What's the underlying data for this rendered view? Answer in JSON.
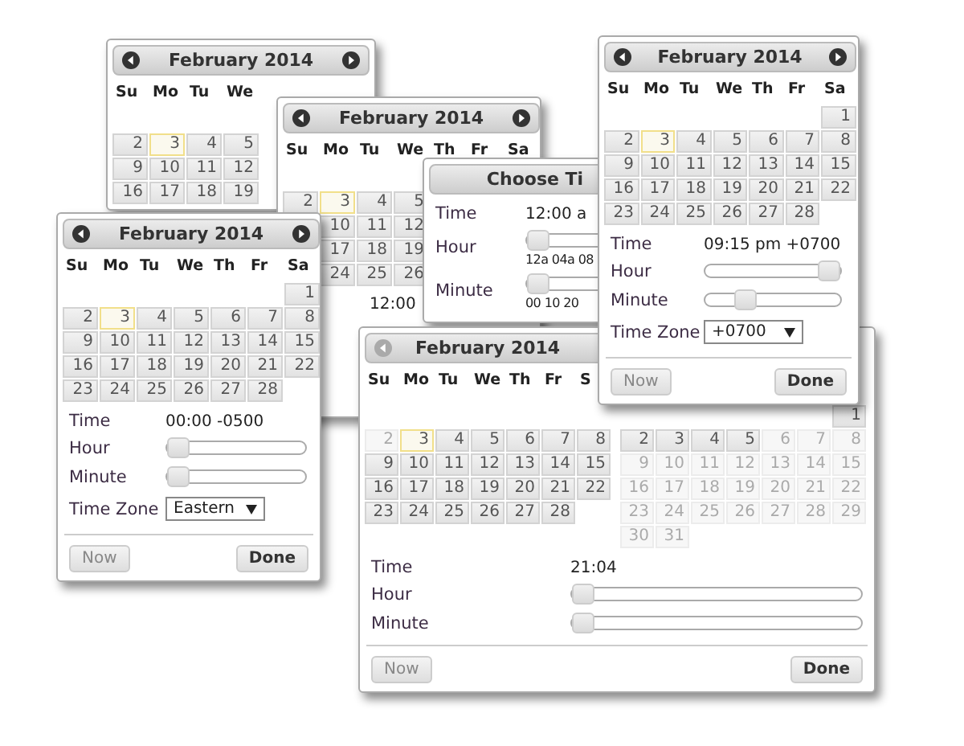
{
  "windows": [
    {
      "kind": "datepicker",
      "months": [
        {
          "title": "February 2014",
          "prev": {
            "disabled": false
          },
          "next": {
            "disabled": false
          },
          "weekdays": [
            "Su",
            "Mo",
            "Tu",
            "We"
          ],
          "weeks": [
            [
              {
                "kind": "blank"
              }
            ],
            [
              {
                "kind": "day",
                "day": "2",
                "today": false,
                "disabled": false
              },
              {
                "kind": "day",
                "day": "3",
                "today": true,
                "disabled": false
              },
              {
                "kind": "day",
                "day": "4",
                "today": false,
                "disabled": false
              },
              {
                "kind": "day",
                "day": "5",
                "today": false,
                "disabled": false
              }
            ],
            [
              {
                "kind": "day",
                "day": "9",
                "today": false,
                "disabled": false
              },
              {
                "kind": "day",
                "day": "10",
                "today": false,
                "disabled": false
              },
              {
                "kind": "day",
                "day": "11",
                "today": false,
                "disabled": false
              },
              {
                "kind": "day",
                "day": "12",
                "today": false,
                "disabled": false
              }
            ],
            [
              {
                "kind": "day",
                "day": "16",
                "today": false,
                "disabled": false
              },
              {
                "kind": "day",
                "day": "17",
                "today": false,
                "disabled": false
              },
              {
                "kind": "day",
                "day": "18",
                "today": false,
                "disabled": false
              },
              {
                "kind": "day",
                "day": "19",
                "today": false,
                "disabled": false
              }
            ]
          ]
        }
      ]
    },
    {
      "kind": "datepicker",
      "months": [
        {
          "title": "February 2014",
          "prev": {
            "disabled": false
          },
          "next": {
            "disabled": false
          },
          "weekdays": [
            "Su",
            "Mo",
            "Tu",
            "We",
            "Th",
            "Fr",
            "Sa"
          ],
          "weeks": [
            [
              {
                "kind": "blank"
              }
            ],
            [
              {
                "kind": "day",
                "day": "2",
                "today": false,
                "disabled": false
              },
              {
                "kind": "day",
                "day": "3",
                "today": true,
                "disabled": false
              },
              {
                "kind": "day",
                "day": "4",
                "today": false,
                "disabled": false
              },
              {
                "kind": "day",
                "day": "5",
                "today": false,
                "disabled": false
              }
            ],
            [
              {
                "kind": "blank"
              },
              {
                "kind": "day",
                "day": "10",
                "today": false,
                "disabled": false
              },
              {
                "kind": "day",
                "day": "11",
                "today": false,
                "disabled": false
              },
              {
                "kind": "day",
                "day": "12",
                "today": false,
                "disabled": false
              }
            ],
            [
              {
                "kind": "blank"
              },
              {
                "kind": "day",
                "day": "17",
                "today": false,
                "disabled": false
              },
              {
                "kind": "day",
                "day": "18",
                "today": false,
                "disabled": false
              },
              {
                "kind": "day",
                "day": "19",
                "today": false,
                "disabled": false
              }
            ],
            [
              {
                "kind": "blank"
              },
              {
                "kind": "day",
                "day": "24",
                "today": false,
                "disabled": false
              },
              {
                "kind": "day",
                "day": "25",
                "today": false,
                "disabled": false
              },
              {
                "kind": "day",
                "day": "26",
                "today": false,
                "disabled": false
              }
            ]
          ]
        }
      ],
      "time": [
        {
          "kind": "text",
          "value": "12:00"
        }
      ]
    },
    {
      "kind": "timepicker",
      "title": "Choose Ti",
      "time": [
        {
          "kind": "text",
          "label": "Time",
          "value": "12:00 a"
        },
        {
          "kind": "slider",
          "label": "Hour",
          "level": 0,
          "ticks": "12a 04a 08"
        },
        {
          "kind": "slider",
          "label": "Minute",
          "level": 0,
          "ticks": "00 10 20"
        }
      ]
    },
    {
      "kind": "datepicker",
      "months": [
        {
          "title": "February 2014",
          "prev": {
            "disabled": false
          },
          "next": {
            "disabled": false
          },
          "weekdays": [
            "Su",
            "Mo",
            "Tu",
            "We",
            "Th",
            "Fr",
            "Sa"
          ],
          "weeks": [
            [
              {
                "kind": "blank"
              },
              {
                "kind": "blank"
              },
              {
                "kind": "blank"
              },
              {
                "kind": "blank"
              },
              {
                "kind": "blank"
              },
              {
                "kind": "blank"
              },
              {
                "kind": "day",
                "day": "1",
                "today": false,
                "disabled": false
              }
            ],
            [
              {
                "kind": "day",
                "day": "2",
                "today": false,
                "disabled": false
              },
              {
                "kind": "day",
                "day": "3",
                "today": true,
                "disabled": false
              },
              {
                "kind": "day",
                "day": "4",
                "today": false,
                "disabled": false
              },
              {
                "kind": "day",
                "day": "5",
                "today": false,
                "disabled": false
              },
              {
                "kind": "day",
                "day": "6",
                "today": false,
                "disabled": false
              },
              {
                "kind": "day",
                "day": "7",
                "today": false,
                "disabled": false
              },
              {
                "kind": "day",
                "day": "8",
                "today": false,
                "disabled": false
              }
            ],
            [
              {
                "kind": "day",
                "day": "9",
                "today": false,
                "disabled": false
              },
              {
                "kind": "day",
                "day": "10",
                "today": false,
                "disabled": false
              },
              {
                "kind": "day",
                "day": "11",
                "today": false,
                "disabled": false
              },
              {
                "kind": "day",
                "day": "12",
                "today": false,
                "disabled": false
              },
              {
                "kind": "day",
                "day": "13",
                "today": false,
                "disabled": false
              },
              {
                "kind": "day",
                "day": "14",
                "today": false,
                "disabled": false
              },
              {
                "kind": "day",
                "day": "15",
                "today": false,
                "disabled": false
              }
            ],
            [
              {
                "kind": "day",
                "day": "16",
                "today": false,
                "disabled": false
              },
              {
                "kind": "day",
                "day": "17",
                "today": false,
                "disabled": false
              },
              {
                "kind": "day",
                "day": "18",
                "today": false,
                "disabled": false
              },
              {
                "kind": "day",
                "day": "19",
                "today": false,
                "disabled": false
              },
              {
                "kind": "day",
                "day": "20",
                "today": false,
                "disabled": false
              },
              {
                "kind": "day",
                "day": "21",
                "today": false,
                "disabled": false
              },
              {
                "kind": "day",
                "day": "22",
                "today": false,
                "disabled": false
              }
            ],
            [
              {
                "kind": "day",
                "day": "23",
                "today": false,
                "disabled": false
              },
              {
                "kind": "day",
                "day": "24",
                "today": false,
                "disabled": false
              },
              {
                "kind": "day",
                "day": "25",
                "today": false,
                "disabled": false
              },
              {
                "kind": "day",
                "day": "26",
                "today": false,
                "disabled": false
              },
              {
                "kind": "day",
                "day": "27",
                "today": false,
                "disabled": false
              },
              {
                "kind": "day",
                "day": "28",
                "today": false,
                "disabled": false
              }
            ]
          ]
        }
      ],
      "time": [
        {
          "kind": "text",
          "label": "Time",
          "value": "00:00 -0500"
        },
        {
          "kind": "slider",
          "label": "Hour",
          "level": 0
        },
        {
          "kind": "slider",
          "label": "Minute",
          "level": 0
        },
        {
          "kind": "select",
          "label": "Time Zone",
          "value": "Eastern"
        }
      ],
      "footer": {
        "now": {
          "label": "Now",
          "disabled": true
        },
        "done": {
          "label": "Done",
          "disabled": false
        }
      }
    },
    {
      "kind": "datepicker",
      "months": [
        {
          "title": "February 2014",
          "prev": {
            "disabled": true
          },
          "weekdays": [
            "Su",
            "Mo",
            "Tu",
            "We",
            "Th",
            "Fr",
            "S"
          ],
          "weeks": [
            [
              {
                "kind": "blank"
              }
            ],
            [
              {
                "kind": "day",
                "day": "2",
                "today": false,
                "disabled": true
              },
              {
                "kind": "day",
                "day": "3",
                "today": true,
                "disabled": false
              },
              {
                "kind": "day",
                "day": "4",
                "today": false,
                "disabled": false
              },
              {
                "kind": "day",
                "day": "5",
                "today": false,
                "disabled": false
              },
              {
                "kind": "day",
                "day": "6",
                "today": false,
                "disabled": false
              },
              {
                "kind": "day",
                "day": "7",
                "today": false,
                "disabled": false
              },
              {
                "kind": "day",
                "day": "8",
                "today": false,
                "disabled": false
              }
            ],
            [
              {
                "kind": "day",
                "day": "9",
                "today": false,
                "disabled": false
              },
              {
                "kind": "day",
                "day": "10",
                "today": false,
                "disabled": false
              },
              {
                "kind": "day",
                "day": "11",
                "today": false,
                "disabled": false
              },
              {
                "kind": "day",
                "day": "12",
                "today": false,
                "disabled": false
              },
              {
                "kind": "day",
                "day": "13",
                "today": false,
                "disabled": false
              },
              {
                "kind": "day",
                "day": "14",
                "today": false,
                "disabled": false
              },
              {
                "kind": "day",
                "day": "15",
                "today": false,
                "disabled": false
              }
            ],
            [
              {
                "kind": "day",
                "day": "16",
                "today": false,
                "disabled": false
              },
              {
                "kind": "day",
                "day": "17",
                "today": false,
                "disabled": false
              },
              {
                "kind": "day",
                "day": "18",
                "today": false,
                "disabled": false
              },
              {
                "kind": "day",
                "day": "19",
                "today": false,
                "disabled": false
              },
              {
                "kind": "day",
                "day": "20",
                "today": false,
                "disabled": false
              },
              {
                "kind": "day",
                "day": "21",
                "today": false,
                "disabled": false
              },
              {
                "kind": "day",
                "day": "22",
                "today": false,
                "disabled": false
              }
            ],
            [
              {
                "kind": "day",
                "day": "23",
                "today": false,
                "disabled": false
              },
              {
                "kind": "day",
                "day": "24",
                "today": false,
                "disabled": false
              },
              {
                "kind": "day",
                "day": "25",
                "today": false,
                "disabled": false
              },
              {
                "kind": "day",
                "day": "26",
                "today": false,
                "disabled": false
              },
              {
                "kind": "day",
                "day": "27",
                "today": false,
                "disabled": false
              },
              {
                "kind": "day",
                "day": "28",
                "today": false,
                "disabled": false
              }
            ]
          ]
        },
        {
          "weeks": [
            [
              {
                "kind": "blank"
              },
              {
                "kind": "blank"
              },
              {
                "kind": "blank"
              },
              {
                "kind": "blank"
              },
              {
                "kind": "blank"
              },
              {
                "kind": "blank"
              },
              {
                "kind": "day",
                "day": "1",
                "today": false,
                "disabled": false
              }
            ],
            [
              {
                "kind": "day",
                "day": "2",
                "today": false,
                "disabled": false
              },
              {
                "kind": "day",
                "day": "3",
                "today": false,
                "disabled": false
              },
              {
                "kind": "day",
                "day": "4",
                "today": false,
                "disabled": false
              },
              {
                "kind": "day",
                "day": "5",
                "today": false,
                "disabled": false
              },
              {
                "kind": "day",
                "day": "6",
                "today": false,
                "disabled": true
              },
              {
                "kind": "day",
                "day": "7",
                "today": false,
                "disabled": true
              },
              {
                "kind": "day",
                "day": "8",
                "today": false,
                "disabled": true
              }
            ],
            [
              {
                "kind": "day",
                "day": "9",
                "today": false,
                "disabled": true
              },
              {
                "kind": "day",
                "day": "10",
                "today": false,
                "disabled": true
              },
              {
                "kind": "day",
                "day": "11",
                "today": false,
                "disabled": true
              },
              {
                "kind": "day",
                "day": "12",
                "today": false,
                "disabled": true
              },
              {
                "kind": "day",
                "day": "13",
                "today": false,
                "disabled": true
              },
              {
                "kind": "day",
                "day": "14",
                "today": false,
                "disabled": true
              },
              {
                "kind": "day",
                "day": "15",
                "today": false,
                "disabled": true
              }
            ],
            [
              {
                "kind": "day",
                "day": "16",
                "today": false,
                "disabled": true
              },
              {
                "kind": "day",
                "day": "17",
                "today": false,
                "disabled": true
              },
              {
                "kind": "day",
                "day": "18",
                "today": false,
                "disabled": true
              },
              {
                "kind": "day",
                "day": "19",
                "today": false,
                "disabled": true
              },
              {
                "kind": "day",
                "day": "20",
                "today": false,
                "disabled": true
              },
              {
                "kind": "day",
                "day": "21",
                "today": false,
                "disabled": true
              },
              {
                "kind": "day",
                "day": "22",
                "today": false,
                "disabled": true
              }
            ],
            [
              {
                "kind": "day",
                "day": "23",
                "today": false,
                "disabled": true
              },
              {
                "kind": "day",
                "day": "24",
                "today": false,
                "disabled": true
              },
              {
                "kind": "day",
                "day": "25",
                "today": false,
                "disabled": true
              },
              {
                "kind": "day",
                "day": "26",
                "today": false,
                "disabled": true
              },
              {
                "kind": "day",
                "day": "27",
                "today": false,
                "disabled": true
              },
              {
                "kind": "day",
                "day": "28",
                "today": false,
                "disabled": true
              },
              {
                "kind": "day",
                "day": "29",
                "today": false,
                "disabled": true
              }
            ],
            [
              {
                "kind": "day",
                "day": "30",
                "today": false,
                "disabled": true
              },
              {
                "kind": "day",
                "day": "31",
                "today": false,
                "disabled": true
              }
            ]
          ]
        }
      ],
      "time": [
        {
          "kind": "text",
          "label": "Time",
          "value": "21:04"
        },
        {
          "kind": "slider",
          "label": "Hour",
          "level": 0
        },
        {
          "kind": "slider",
          "label": "Minute",
          "level": 0
        }
      ],
      "footer": {
        "now": {
          "label": "Now",
          "disabled": true
        },
        "done": {
          "label": "Done",
          "disabled": false
        }
      }
    },
    {
      "kind": "datepicker",
      "months": [
        {
          "title": "February 2014",
          "prev": {
            "disabled": false
          },
          "next": {
            "disabled": false
          },
          "weekdays": [
            "Su",
            "Mo",
            "Tu",
            "We",
            "Th",
            "Fr",
            "Sa"
          ],
          "weeks": [
            [
              {
                "kind": "blank"
              },
              {
                "kind": "blank"
              },
              {
                "kind": "blank"
              },
              {
                "kind": "blank"
              },
              {
                "kind": "blank"
              },
              {
                "kind": "blank"
              },
              {
                "kind": "day",
                "day": "1",
                "today": false,
                "disabled": false
              }
            ],
            [
              {
                "kind": "day",
                "day": "2",
                "today": false,
                "disabled": false
              },
              {
                "kind": "day",
                "day": "3",
                "today": true,
                "disabled": false
              },
              {
                "kind": "day",
                "day": "4",
                "today": false,
                "disabled": false
              },
              {
                "kind": "day",
                "day": "5",
                "today": false,
                "disabled": false
              },
              {
                "kind": "day",
                "day": "6",
                "today": false,
                "disabled": false
              },
              {
                "kind": "day",
                "day": "7",
                "today": false,
                "disabled": false
              },
              {
                "kind": "day",
                "day": "8",
                "today": false,
                "disabled": false
              }
            ],
            [
              {
                "kind": "day",
                "day": "9",
                "today": false,
                "disabled": false
              },
              {
                "kind": "day",
                "day": "10",
                "today": false,
                "disabled": false
              },
              {
                "kind": "day",
                "day": "11",
                "today": false,
                "disabled": false
              },
              {
                "kind": "day",
                "day": "12",
                "today": false,
                "disabled": false
              },
              {
                "kind": "day",
                "day": "13",
                "today": false,
                "disabled": false
              },
              {
                "kind": "day",
                "day": "14",
                "today": false,
                "disabled": false
              },
              {
                "kind": "day",
                "day": "15",
                "today": false,
                "disabled": false
              }
            ],
            [
              {
                "kind": "day",
                "day": "16",
                "today": false,
                "disabled": false
              },
              {
                "kind": "day",
                "day": "17",
                "today": false,
                "disabled": false
              },
              {
                "kind": "day",
                "day": "18",
                "today": false,
                "disabled": false
              },
              {
                "kind": "day",
                "day": "19",
                "today": false,
                "disabled": false
              },
              {
                "kind": "day",
                "day": "20",
                "today": false,
                "disabled": false
              },
              {
                "kind": "day",
                "day": "21",
                "today": false,
                "disabled": false
              },
              {
                "kind": "day",
                "day": "22",
                "today": false,
                "disabled": false
              }
            ],
            [
              {
                "kind": "day",
                "day": "23",
                "today": false,
                "disabled": false
              },
              {
                "kind": "day",
                "day": "24",
                "today": false,
                "disabled": false
              },
              {
                "kind": "day",
                "day": "25",
                "today": false,
                "disabled": false
              },
              {
                "kind": "day",
                "day": "26",
                "today": false,
                "disabled": false
              },
              {
                "kind": "day",
                "day": "27",
                "today": false,
                "disabled": false
              },
              {
                "kind": "day",
                "day": "28",
                "today": false,
                "disabled": false
              }
            ]
          ]
        }
      ],
      "time": [
        {
          "kind": "text",
          "label": "Time",
          "value": "09:15 pm +0700"
        },
        {
          "kind": "slider",
          "label": "Hour",
          "level": 1
        },
        {
          "kind": "slider",
          "label": "Minute",
          "level": 0.25
        },
        {
          "kind": "select",
          "label": "Time Zone",
          "value": "+0700"
        }
      ],
      "footer": {
        "now": {
          "label": "Now",
          "disabled": true
        },
        "done": {
          "label": "Done",
          "disabled": false
        }
      }
    }
  ]
}
